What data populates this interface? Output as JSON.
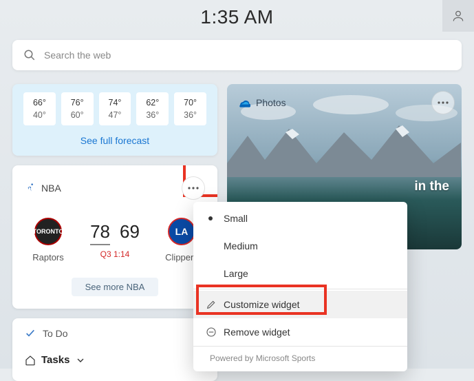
{
  "clock": "1:35 AM",
  "search": {
    "placeholder": "Search the web"
  },
  "weather": {
    "days": [
      {
        "hi": "66°",
        "lo": "40°"
      },
      {
        "hi": "76°",
        "lo": "60°"
      },
      {
        "hi": "74°",
        "lo": "47°"
      },
      {
        "hi": "62°",
        "lo": "36°"
      },
      {
        "hi": "70°",
        "lo": "36°"
      }
    ],
    "see_forecast": "See full forecast"
  },
  "sports": {
    "league": "NBA",
    "home": {
      "name": "Raptors",
      "score": "78"
    },
    "away": {
      "name": "Clippers",
      "score": "69"
    },
    "status": "Q3 1:14",
    "see_more": "See more NBA"
  },
  "photos": {
    "title": "Photos",
    "caption": "in the"
  },
  "todo": {
    "title": "To Do",
    "tasks_label": "Tasks"
  },
  "menu": {
    "small": "Small",
    "medium": "Medium",
    "large": "Large",
    "customize": "Customize widget",
    "remove": "Remove widget",
    "powered": "Powered by Microsoft Sports"
  }
}
